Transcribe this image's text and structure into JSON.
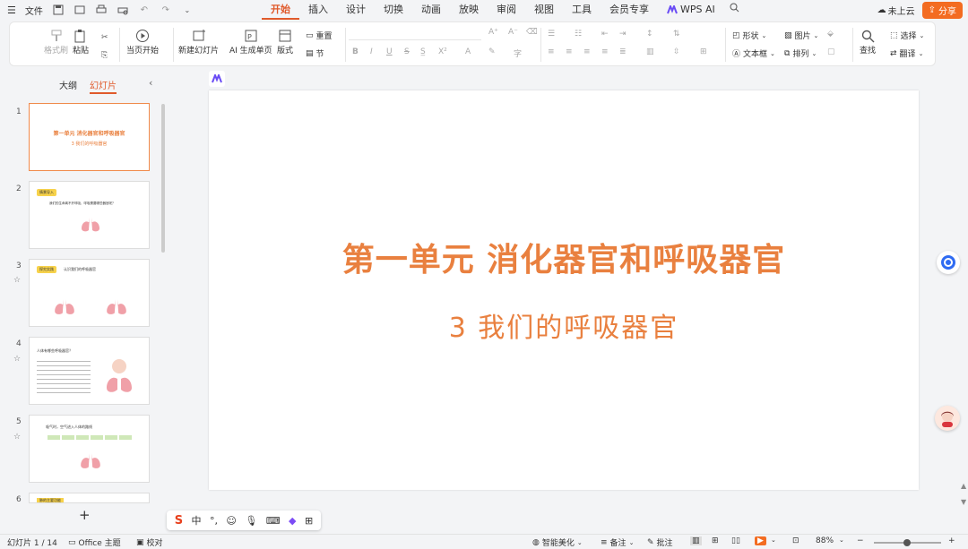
{
  "topbar": {
    "file_label": "文件",
    "tabs": [
      "开始",
      "插入",
      "设计",
      "切换",
      "动画",
      "放映",
      "审阅",
      "视图",
      "工具",
      "会员专享",
      "WPS AI"
    ],
    "cloud_label": "未上云",
    "share_label": "分享"
  },
  "ribbon": {
    "format_painter": "格式刷",
    "paste": "粘贴",
    "start_from_current": "当页开始",
    "new_slide": "新建幻灯片",
    "ai_generate": "AI 生成单页",
    "layout": "版式",
    "reset": "重置",
    "section": "节",
    "font_a_up": "A⁺",
    "font_a_down": "A⁻",
    "bold": "B",
    "italic": "I",
    "underline": "U",
    "strike": "S",
    "superscript": "X²",
    "shape": "形状",
    "picture": "图片",
    "textbox": "文本框",
    "arrange": "排列",
    "find": "查找",
    "select": "选择",
    "translate": "翻译"
  },
  "panel": {
    "tab_outline": "大纲",
    "tab_slides": "幻灯片",
    "thumbnails": [
      {
        "num": "1",
        "title": "第一单元  消化器官和呼吸器官",
        "sub": "3  我们的呼吸器官"
      },
      {
        "num": "2",
        "tag": "情景导入",
        "text": "我们的生命离不开呼吸，呼吸需要哪些器官呢？"
      },
      {
        "num": "3",
        "tag": "探究实践",
        "text": "认识我们的呼吸器官"
      },
      {
        "num": "4",
        "text": "人体有哪些呼吸器官？"
      },
      {
        "num": "5",
        "text": "吸气时，空气进入人体的路线"
      },
      {
        "num": "6",
        "text": "肺的主要功能"
      }
    ]
  },
  "slide": {
    "title": "第一单元  消化器官和呼吸器官",
    "subtitle": "3  我们的呼吸器官"
  },
  "ime": {
    "lang": "中"
  },
  "status": {
    "slide_counter": "幻灯片 1 / 14",
    "theme": "Office 主题",
    "proof": "校对",
    "beautify": "智能美化",
    "notes": "备注",
    "comments": "批注",
    "zoom": "88%"
  },
  "colors": {
    "accent": "#e05a2b",
    "title_orange": "#e9803f",
    "share_bg": "#f36c21"
  }
}
